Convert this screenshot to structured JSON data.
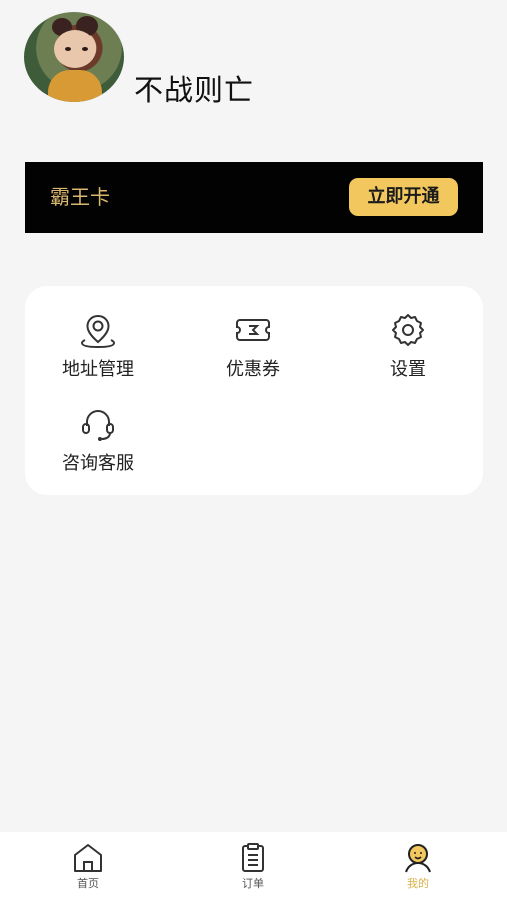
{
  "profile": {
    "username": "不战则亡"
  },
  "vip_card": {
    "title": "霸王卡",
    "action_label": "立即开通"
  },
  "menu_items": [
    {
      "label": "地址管理",
      "icon": "location-icon"
    },
    {
      "label": "优惠券",
      "icon": "coupon-icon"
    },
    {
      "label": "设置",
      "icon": "gear-icon"
    },
    {
      "label": "咨询客服",
      "icon": "headset-icon"
    }
  ],
  "tabbar": {
    "tabs": [
      {
        "label": "首页",
        "icon": "home-icon",
        "active": false
      },
      {
        "label": "订单",
        "icon": "clipboard-icon",
        "active": false
      },
      {
        "label": "我的",
        "icon": "user-smile-icon",
        "active": true
      }
    ]
  },
  "colors": {
    "background": "#f5f5f5",
    "vip_bg": "#020202",
    "vip_title": "#d9b86d",
    "vip_button": "#f2c85e",
    "active_tab": "#d8b24b"
  }
}
